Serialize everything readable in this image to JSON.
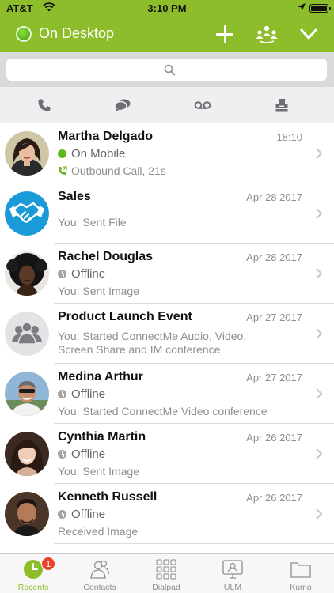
{
  "status_bar": {
    "carrier": "AT&T",
    "time": "3:10 PM"
  },
  "header": {
    "title": "On Desktop",
    "presence_color": "#4caf1f"
  },
  "search": {
    "placeholder": ""
  },
  "filters": [
    "phone-icon",
    "chat-icon",
    "voicemail-icon",
    "fax-icon"
  ],
  "recents": [
    {
      "name": "Martha Delgado",
      "date": "18:10",
      "status": "On Mobile",
      "status_type": "online",
      "detail": "Outbound Call, 21s"
    },
    {
      "name": "Sales",
      "date": "Apr 28 2017",
      "detail": "You: Sent File"
    },
    {
      "name": "Rachel Douglas",
      "date": "Apr 28 2017",
      "status": "Offline",
      "status_type": "offline",
      "detail": "You: Sent Image"
    },
    {
      "name": "Product Launch Event",
      "date": "Apr 27 2017",
      "detail": "You: Started ConnectMe Audio, Video, Screen Share and IM conference"
    },
    {
      "name": "Medina Arthur",
      "date": "Apr 27 2017",
      "status": "Offline",
      "status_type": "offline",
      "detail": "You: Started ConnectMe Video conference"
    },
    {
      "name": "Cynthia Martin",
      "date": "Apr 26 2017",
      "status": "Offline",
      "status_type": "offline",
      "detail": "You: Sent Image"
    },
    {
      "name": "Kenneth Russell",
      "date": "Apr 26 2017",
      "status": "Offline",
      "status_type": "offline",
      "detail": "Received Image"
    }
  ],
  "tabbar": {
    "recents": {
      "label": "Recents",
      "badge": "1"
    },
    "contacts": {
      "label": "Contacts"
    },
    "dialpad": {
      "label": "Dialpad"
    },
    "ulm": {
      "label": "ULM"
    },
    "kumo": {
      "label": "Kumo"
    }
  },
  "colors": {
    "accent": "#8ebd2b",
    "badge": "#e8412c",
    "sales_avatar": "#1a9ad6"
  }
}
